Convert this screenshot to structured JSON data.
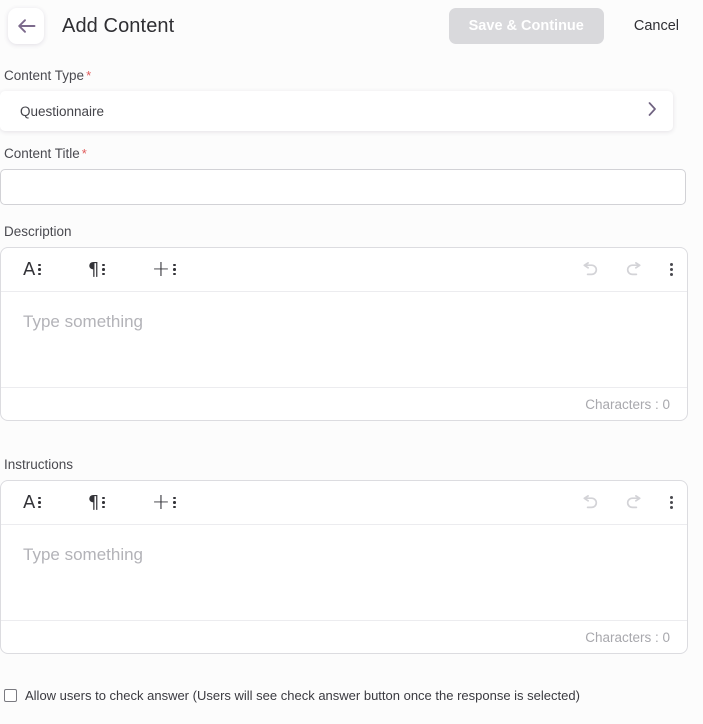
{
  "header": {
    "back_icon": "arrow-left-icon",
    "title": "Add Content",
    "save_label": "Save & Continue",
    "cancel_label": "Cancel",
    "save_disabled": true,
    "save_bg": "#d9d9dc",
    "save_text_color": "#ffffff"
  },
  "content_type": {
    "label": "Content Type",
    "required_marker": "*",
    "value": "Questionnaire",
    "chevron_icon": "chevron-right-icon"
  },
  "content_title": {
    "label": "Content Title",
    "required_marker": "*",
    "value": "",
    "placeholder": ""
  },
  "description": {
    "label": "Description",
    "toolbar": {
      "text_style_glyph": "A",
      "text_style_icon": "text-style-icon",
      "paragraph_glyph": "¶",
      "paragraph_icon": "paragraph-style-icon",
      "insert_glyph": "+",
      "insert_icon": "insert-icon",
      "undo_icon": "undo-icon",
      "redo_icon": "redo-icon",
      "more_icon": "more-options-icon"
    },
    "placeholder": "Type something",
    "body_text": "",
    "char_count_label": "Characters : 0"
  },
  "instructions": {
    "label": "Instructions",
    "toolbar": {
      "text_style_glyph": "A",
      "text_style_icon": "text-style-icon",
      "paragraph_glyph": "¶",
      "paragraph_icon": "paragraph-style-icon",
      "insert_glyph": "+",
      "insert_icon": "insert-icon",
      "undo_icon": "undo-icon",
      "redo_icon": "redo-icon",
      "more_icon": "more-options-icon"
    },
    "placeholder": "Type something",
    "body_text": "",
    "char_count_label": "Characters : 0"
  },
  "check_answer": {
    "checked": false,
    "label": "Allow users to check answer (Users will see check answer button once the response is selected)"
  },
  "colors": {
    "page_background": "#fcfcfc",
    "card_background": "#ffffff",
    "accent_purple": "#7c6a8c",
    "required_red": "#e05a5a",
    "muted_text": "#a8a8ad",
    "border": "#dcdce0"
  }
}
